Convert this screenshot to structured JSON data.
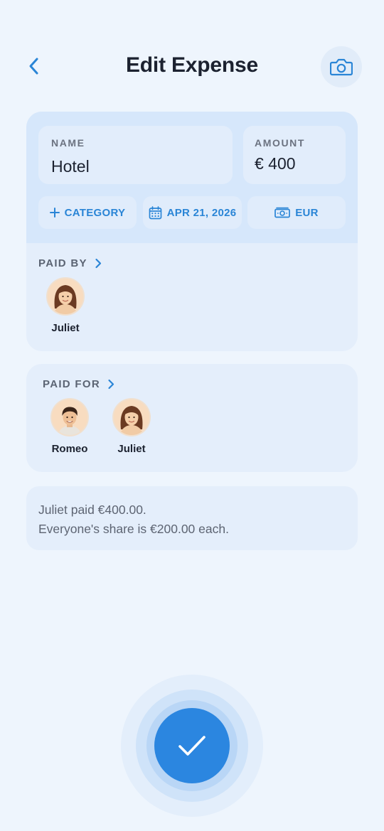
{
  "header": {
    "title": "Edit Expense",
    "back_icon": "chevron-left-icon",
    "camera_icon": "camera-icon"
  },
  "expense": {
    "name_label": "NAME",
    "name_value": "Hotel",
    "amount_label": "AMOUNT",
    "amount_value": "€ 400"
  },
  "chips": {
    "category": "CATEGORY",
    "date": "APR 21, 2026",
    "currency": "EUR"
  },
  "paid_by": {
    "label": "PAID BY",
    "people": [
      {
        "name": "Juliet"
      }
    ]
  },
  "paid_for": {
    "label": "PAID FOR",
    "people": [
      {
        "name": "Romeo"
      },
      {
        "name": "Juliet"
      }
    ]
  },
  "summary": {
    "line1": "Juliet paid €400.00.",
    "line2": "Everyone's share is €200.00 each."
  },
  "colors": {
    "accent": "#2b86e0",
    "background": "#eef5fd",
    "card": "#e4eefb"
  }
}
